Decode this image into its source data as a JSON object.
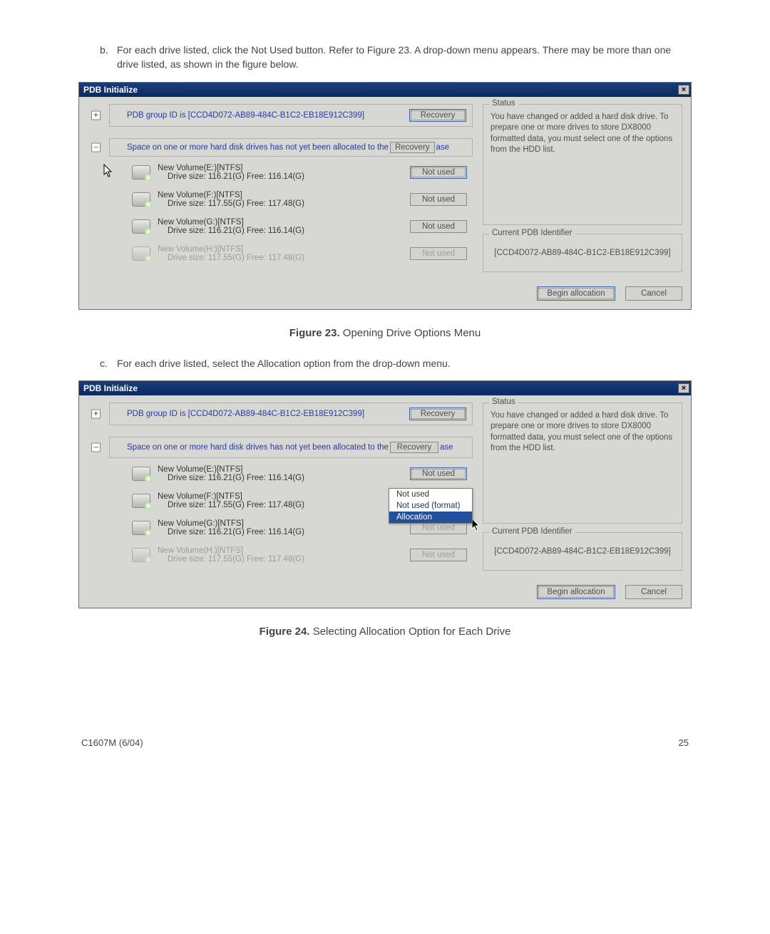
{
  "instructions": {
    "b": {
      "letter": "b.",
      "text": "For each drive listed, click the Not Used button. Refer to Figure 23. A drop-down menu appears. There may be more than one drive listed, as shown in the figure below."
    },
    "c": {
      "letter": "c.",
      "text": "For each drive listed, select the Allocation option from the drop-down menu."
    }
  },
  "figures": {
    "fig23": {
      "label": "Figure 23.",
      "caption": "Opening Drive Options Menu"
    },
    "fig24": {
      "label": "Figure 24.",
      "caption": "Selecting Allocation Option for Each Drive"
    }
  },
  "dialog": {
    "title": "PDB Initialize",
    "close": "×",
    "pdb_line": "PDB group ID is [CCD4D072-AB89-484C-B1C2-EB18E912C399]",
    "recovery": "Recovery",
    "space_line_pre": "Space on one or more hard disk drives has not yet been allocated to the",
    "space_line_suf": "ase",
    "not_used": "Not used",
    "drives": [
      {
        "title": "New Volume(E:)[NTFS]",
        "sub": "Drive size: 116.21(G) Free: 116.14(G)"
      },
      {
        "title": "New Volume(F:)[NTFS]",
        "sub": "Drive size: 117.55(G) Free: 117.48(G)"
      },
      {
        "title": "New Volume(G:)[NTFS]",
        "sub": "Drive size: 116.21(G) Free: 116.14(G)"
      },
      {
        "title": "New Volume(H:)[NTFS]",
        "sub": "Drive size: 117.55(G) Free: 117.48(G)"
      }
    ],
    "status_legend": "Status",
    "status_text": "You have changed or added a hard disk drive. To prepare one or more drives to store DX8000 formatted data, you must select one of the options from the HDD list.",
    "id_legend": "Current PDB Identifier",
    "id_value": "[CCD4D072-AB89-484C-B1C2-EB18E912C399]",
    "begin": "Begin allocation",
    "cancel": "Cancel",
    "dropdown": {
      "opt1": "Not used",
      "opt2": "Not used (format)",
      "opt3": "Allocation"
    },
    "toggles": {
      "plus": "+",
      "minus": "–"
    }
  },
  "footer": {
    "left": "C1607M (6/04)",
    "right": "25"
  }
}
